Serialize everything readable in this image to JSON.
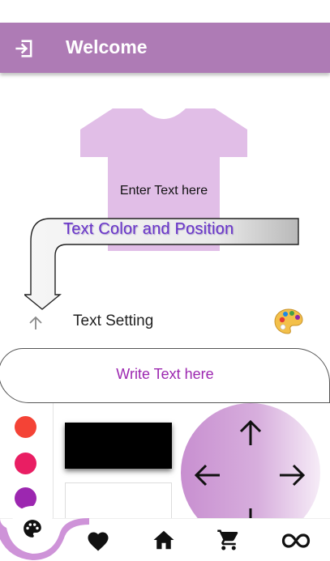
{
  "app_bar": {
    "title": "Welcome",
    "leading_icon": "login-icon",
    "background": "#ae7bb5"
  },
  "preview": {
    "shirt_color": "#e1bee7",
    "shirt_text": "Enter Text here"
  },
  "callout": {
    "text": "Text Color and Position",
    "icon": "bent-arrow-callout"
  },
  "text_setting": {
    "label": "Text Setting",
    "leading_icon": "arrow-up-icon",
    "trailing_icon": "palette-icon"
  },
  "text_input": {
    "placeholder": "Write Text here",
    "color": "#9c27b0"
  },
  "text_colors": [
    "#f44336",
    "#e91e63",
    "#9c27b0"
  ],
  "swatches": [
    "#000000",
    "#ffffff"
  ],
  "position_pad": {
    "icons": [
      "arrow-up-icon",
      "arrow-left-icon",
      "arrow-right-icon",
      "arrow-down-icon"
    ]
  },
  "bottom_nav": {
    "items": [
      {
        "icon": "palette-icon",
        "active": true
      },
      {
        "icon": "heart-icon",
        "active": false
      },
      {
        "icon": "home-icon",
        "active": false
      },
      {
        "icon": "cart-icon",
        "active": false
      },
      {
        "icon": "infinity-icon",
        "active": false
      }
    ],
    "accent": "#ce93d8"
  }
}
